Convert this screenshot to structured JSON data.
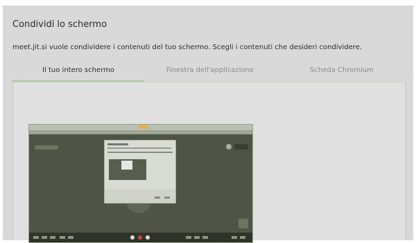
{
  "dialog": {
    "title": "Condividi lo schermo",
    "subtitle": "meet.jit.si vuole condividere i contenuti del tuo schermo. Scegli i contenuti che desideri condividere."
  },
  "tabs": [
    {
      "label": "Il tuo intero schermo",
      "active": true
    },
    {
      "label": "Finestra dell'applicazione",
      "active": false
    },
    {
      "label": "Scheda Chromium",
      "active": false
    }
  ],
  "colors": {
    "tab_underline": "#b2c9a5",
    "dialog_bg": "#d9d9d9",
    "screen_bg": "#4e5446"
  },
  "thumbnail": {
    "semantic": "entire-screen-preview"
  }
}
